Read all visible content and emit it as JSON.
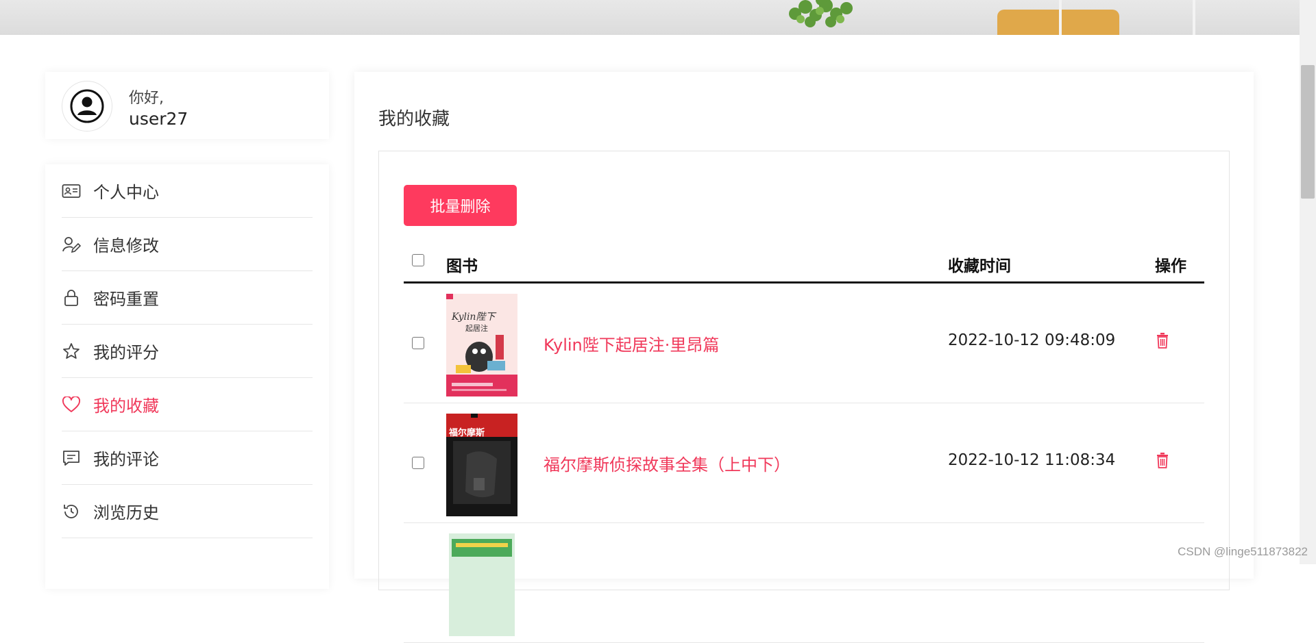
{
  "user": {
    "greeting": "你好,",
    "username": "user27"
  },
  "sidebar": {
    "items": [
      {
        "label": "个人中心",
        "icon": "id-card-icon"
      },
      {
        "label": "信息修改",
        "icon": "user-edit-icon"
      },
      {
        "label": "密码重置",
        "icon": "lock-icon"
      },
      {
        "label": "我的评分",
        "icon": "star-icon"
      },
      {
        "label": "我的收藏",
        "icon": "heart-icon",
        "active": true
      },
      {
        "label": "我的评论",
        "icon": "comment-icon"
      },
      {
        "label": "浏览历史",
        "icon": "history-icon"
      }
    ],
    "active_color": "#f0385a"
  },
  "main": {
    "title": "我的收藏",
    "batch_delete_label": "批量删除",
    "table": {
      "headers": {
        "book": "图书",
        "time": "收藏时间",
        "action": "操作"
      },
      "rows": [
        {
          "title": "Kylin陛下起居注·里昂篇",
          "time": "2022-10-12 09:48:09"
        },
        {
          "title": "福尔摩斯侦探故事全集（上中下）",
          "time": "2022-10-12 11:08:34"
        }
      ]
    }
  },
  "colors": {
    "accent": "#fe3a5e",
    "link": "#f0385a"
  },
  "watermark": "CSDN @linge511873822"
}
